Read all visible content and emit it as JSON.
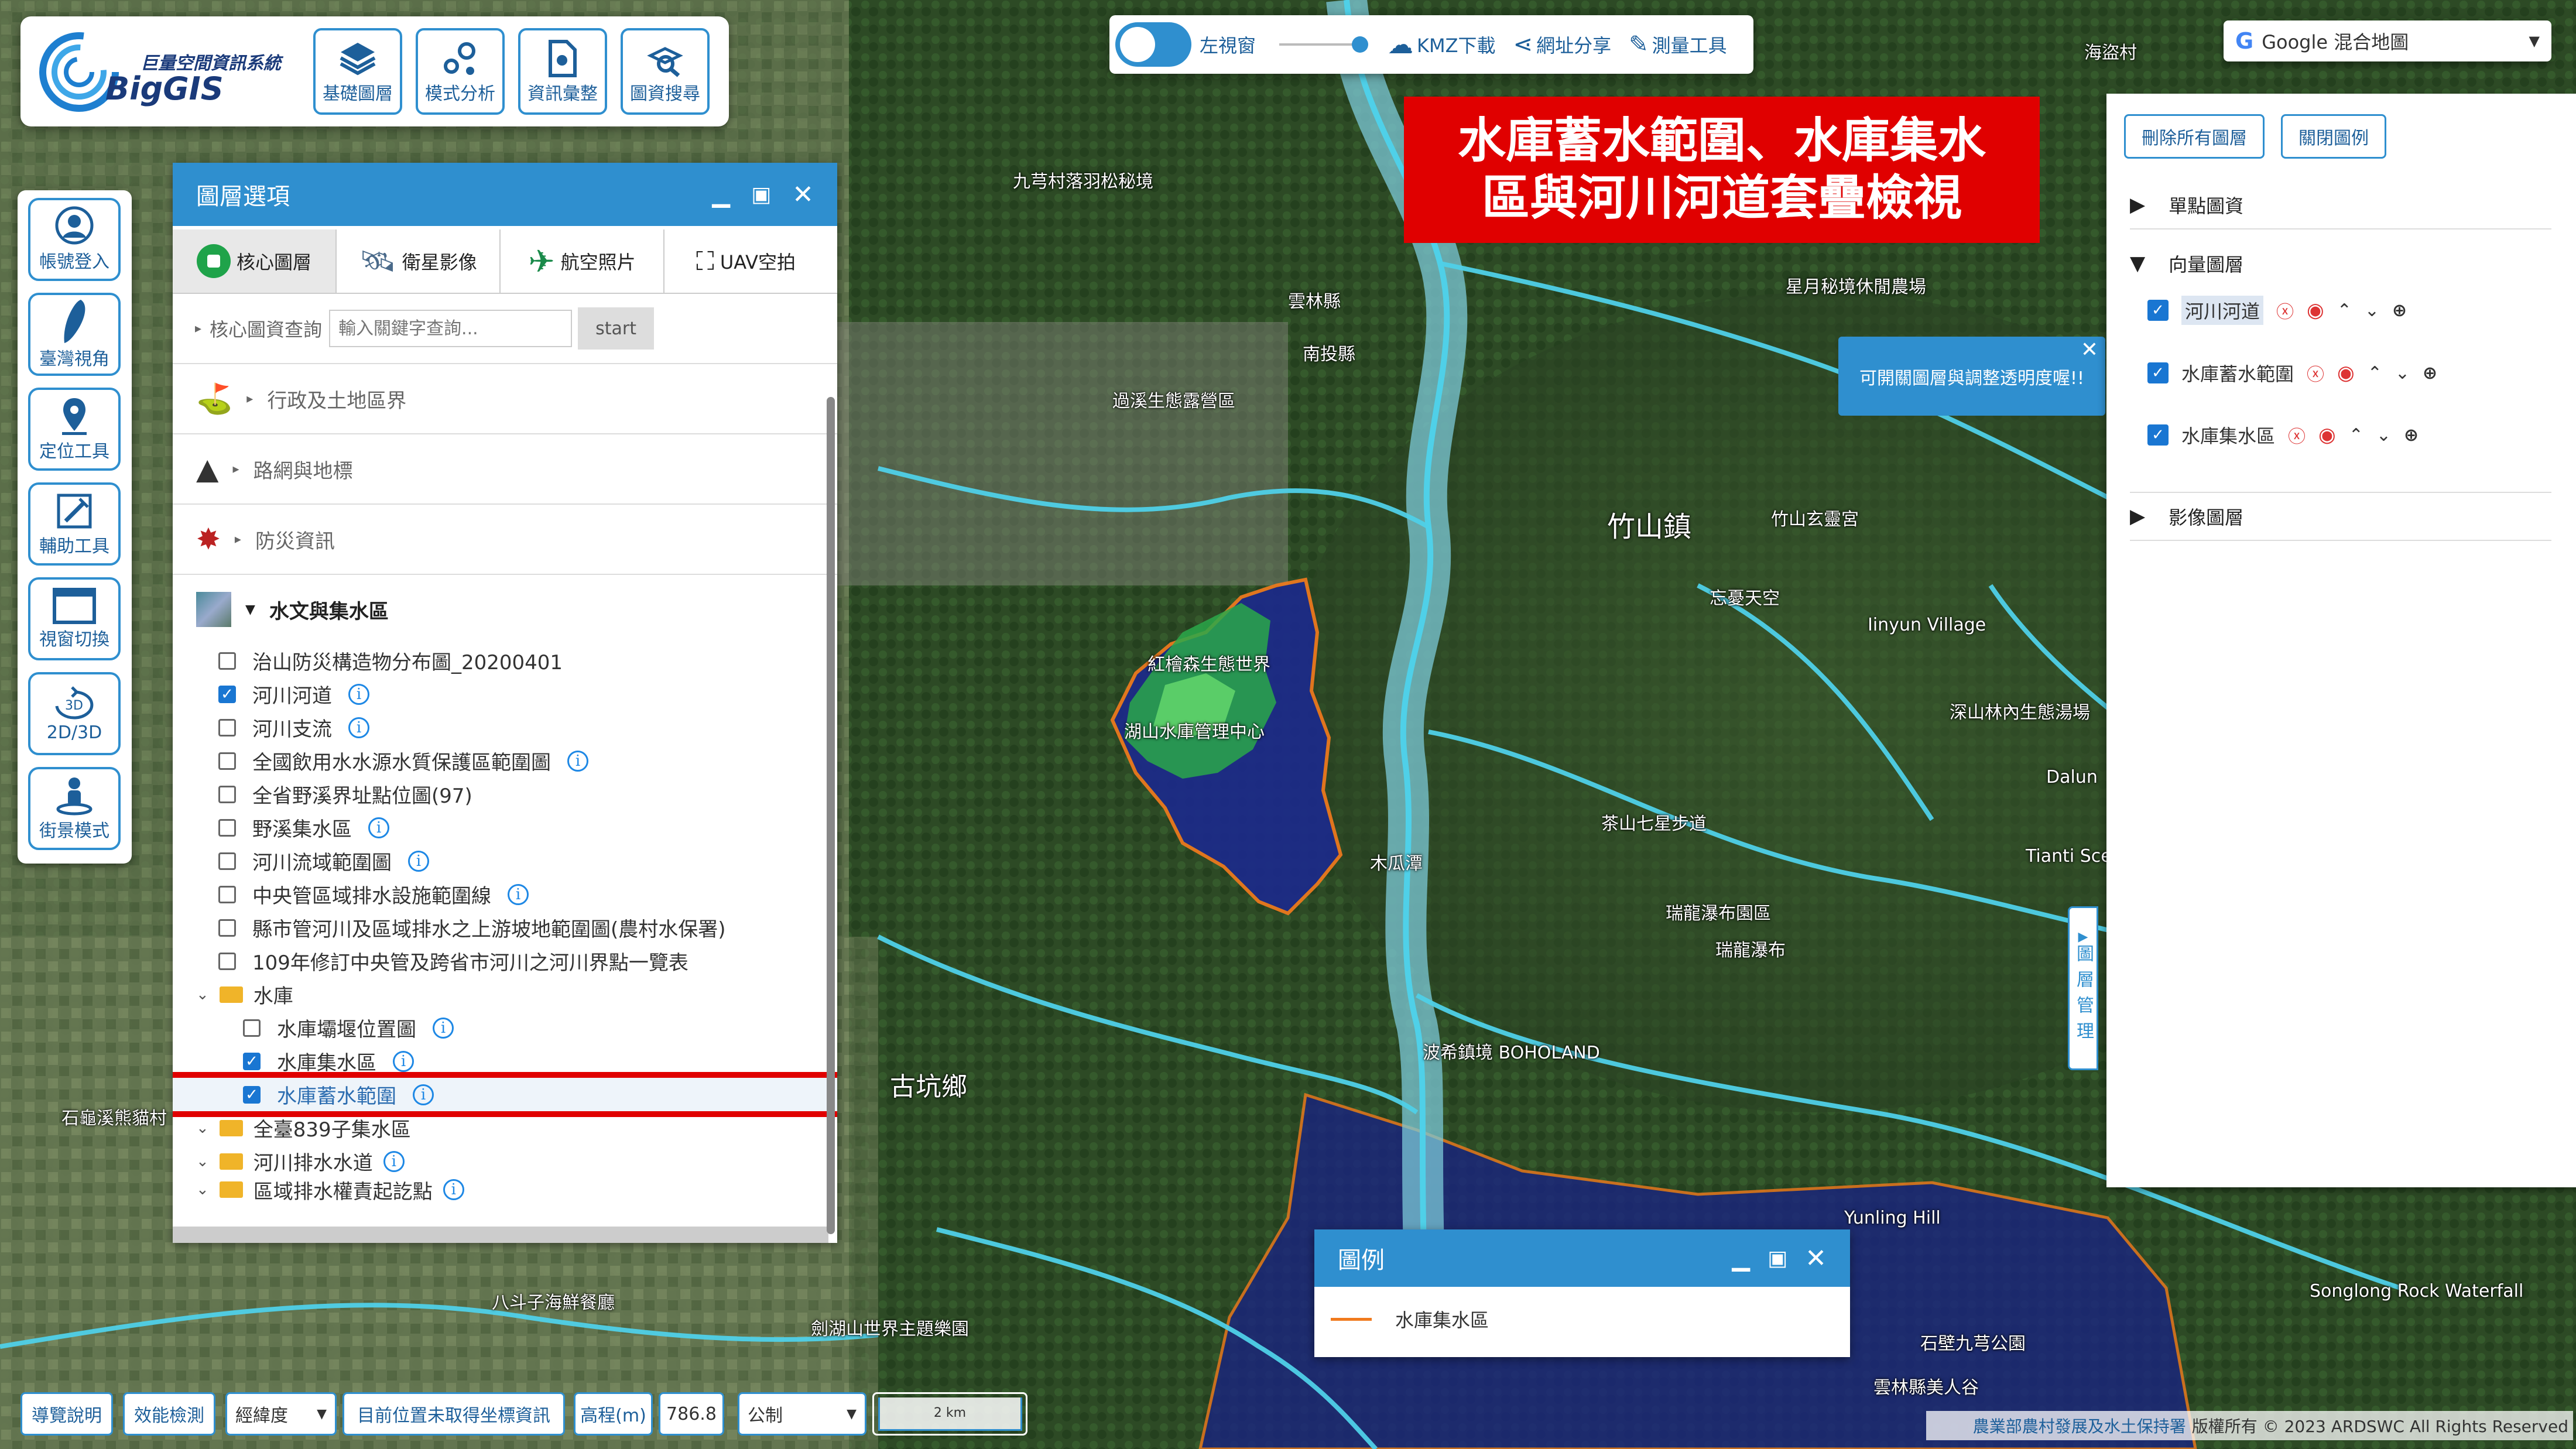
{
  "logo": {
    "title": "巨量空間資訊系統",
    "brand": "BigGIS"
  },
  "top_tools": [
    {
      "label": "基礎圖層",
      "icon": "layers-icon"
    },
    {
      "label": "模式分析",
      "icon": "analysis-icon"
    },
    {
      "label": "資訊彙整",
      "icon": "document-icon"
    },
    {
      "label": "圖資搜尋",
      "icon": "search-map-icon"
    }
  ],
  "toolbar": {
    "left_window": "左視窗",
    "kmz": "KMZ下載",
    "share": "網址分享",
    "measure": "測量工具"
  },
  "basemap": {
    "selected": "Google 混合地圖"
  },
  "left_tools": [
    {
      "label": "帳號登入",
      "icon": "user-icon"
    },
    {
      "label": "臺灣視角",
      "icon": "taiwan-icon"
    },
    {
      "label": "定位工具",
      "icon": "location-pin-icon"
    },
    {
      "label": "輔助工具",
      "icon": "tools-icon"
    },
    {
      "label": "視窗切換",
      "icon": "window-icon"
    },
    {
      "label": "2D/3D",
      "icon": "3d-icon"
    },
    {
      "label": "街景模式",
      "icon": "streetview-icon"
    }
  ],
  "layer_panel": {
    "title": "圖層選項",
    "tabs": [
      {
        "label": "核心圖層",
        "icon": "core-layer-icon"
      },
      {
        "label": "衛星影像",
        "icon": "satellite-icon"
      },
      {
        "label": "航空照片",
        "icon": "airplane-icon"
      },
      {
        "label": "UAV空拍",
        "icon": "drone-icon"
      }
    ],
    "search_label": "核心圖資查詢",
    "search_placeholder": "輸入關鍵字查詢...",
    "search_button": "start",
    "sections": [
      {
        "label": "行政及土地區界"
      },
      {
        "label": "路網與地標"
      },
      {
        "label": "防災資訊"
      }
    ],
    "water_section": "水文與集水區",
    "items": [
      {
        "label": "治山防災構造物分布圖_20200401",
        "checked": false,
        "info": false
      },
      {
        "label": "河川河道",
        "checked": true,
        "info": true
      },
      {
        "label": "河川支流",
        "checked": false,
        "info": true
      },
      {
        "label": "全國飲用水水源水質保護區範圍圖",
        "checked": false,
        "info": true
      },
      {
        "label": "全省野溪界址點位圖(97)",
        "checked": false,
        "info": false
      },
      {
        "label": "野溪集水區",
        "checked": false,
        "info": true
      },
      {
        "label": "河川流域範圍圖",
        "checked": false,
        "info": true
      },
      {
        "label": "中央管區域排水設施範圍線",
        "checked": false,
        "info": true
      },
      {
        "label": "縣市管河川及區域排水之上游坡地範圍圖(農村水保署)",
        "checked": false,
        "info": false
      },
      {
        "label": "109年修訂中央管及跨省市河川之河川界點一覽表",
        "checked": false,
        "info": false
      }
    ],
    "reservoir_folder": "水庫",
    "reservoir_items": [
      {
        "label": "水庫壩堰位置圖",
        "checked": false
      },
      {
        "label": "水庫集水區",
        "checked": true
      },
      {
        "label": "水庫蓄水範圍",
        "checked": true
      }
    ],
    "folders": [
      "全臺839子集水區",
      "河川排水水道",
      "區域排水權責起訖點"
    ]
  },
  "banner": {
    "line1": "水庫蓄水範圍、水庫集水",
    "line2": "區與河川河道套疊檢視"
  },
  "tooltip": "可開關圖層與調整透明度喔!!",
  "right_panel": {
    "remove_all": "刪除所有圖層",
    "close_legend": "關閉圖例",
    "groups": {
      "point": "單點圖資",
      "vector": "向量圖層",
      "image": "影像圖層"
    },
    "vector_layers": [
      {
        "label": "河川河道",
        "checked": true
      },
      {
        "label": "水庫蓄水範圍",
        "checked": true
      },
      {
        "label": "水庫集水區",
        "checked": true
      }
    ],
    "side_tab": "圖層管理"
  },
  "legend": {
    "title": "圖例",
    "item": "水庫集水區",
    "line_color": "#f07a1e"
  },
  "statusbar": {
    "guide": "導覽說明",
    "perf": "效能檢測",
    "coord_type": "經緯度",
    "position": "目前位置未取得坐標資訊",
    "elev_label": "高程(m)",
    "elev_value": "786.8",
    "unit": "公制",
    "scale": "2 km"
  },
  "copyright": {
    "agency": "農業部農村發展及水土保持署",
    "rights": "版權所有 © 2023 ARDSWC All Rights Reserved"
  },
  "map_labels": [
    {
      "text": "竹山鎮"
    },
    {
      "text": "古坑鄉"
    },
    {
      "text": "南投縣"
    },
    {
      "text": "雲林縣"
    },
    {
      "text": "九芎村落羽松秘境"
    },
    {
      "text": "紅檜森生態世界"
    },
    {
      "text": "湖山水庫管理中心"
    },
    {
      "text": "忘憂天空"
    },
    {
      "text": "竹山玄靈宮"
    },
    {
      "text": "茶山七星步道"
    },
    {
      "text": "瑞龍瀑布園區"
    },
    {
      "text": "瑞龍瀑布"
    },
    {
      "text": "波希鎮境 BOHOLAND"
    },
    {
      "text": "石龜溪熊貓村"
    },
    {
      "text": "星月秘境休閒農場"
    },
    {
      "text": "深山林內生態湯場"
    },
    {
      "text": "Yunling Hill"
    },
    {
      "text": "Songlong Rock Waterfall"
    },
    {
      "text": "劍湖山世界主題樂園"
    },
    {
      "text": "八斗子海鮮餐廳"
    },
    {
      "text": "石壁九芎公園"
    },
    {
      "text": "雲林縣美人谷"
    },
    {
      "text": "Iinyun Village"
    },
    {
      "text": "Tianti Sce"
    },
    {
      "text": "Dalun"
    },
    {
      "text": "海盜村"
    },
    {
      "text": "木瓜潭"
    },
    {
      "text": "過溪生態露營區"
    }
  ],
  "colors": {
    "accent": "#2f8fcf",
    "banner_bg": "#e00000",
    "highlight": "#e00000",
    "reservoir_fill": "#1a2a8a",
    "river": "#4fd0e8"
  }
}
